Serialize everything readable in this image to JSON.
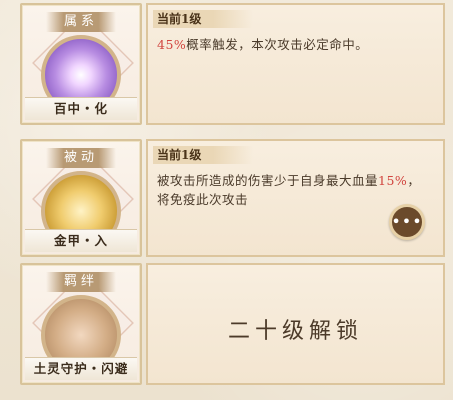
{
  "skills": [
    {
      "category": "属系",
      "name": "百中・化",
      "level": "当前1级",
      "desc_pct": "45%",
      "desc_rest": "概率触发，本次攻击必定命中。"
    },
    {
      "category": "被动",
      "name": "金甲・入",
      "level": "当前1级",
      "desc_pre": "被攻击所造成的伤害少于自身最大血量",
      "desc_pct": "15%",
      "desc_post": "，将免疫此次攻击"
    },
    {
      "category": "羁绊",
      "name": "土灵守护・闪避",
      "locked_text": "二十级解锁"
    }
  ],
  "chat_button": {
    "label": "•••",
    "icon": "speech-bubble-icon"
  }
}
